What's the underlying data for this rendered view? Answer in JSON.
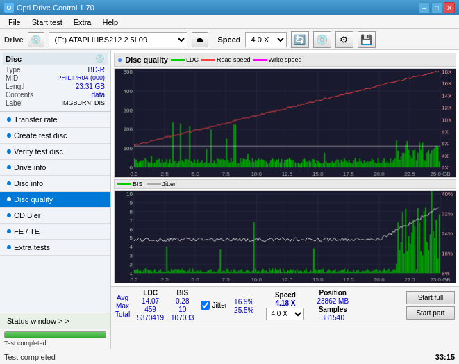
{
  "titlebar": {
    "title": "Opti Drive Control 1.70",
    "min": "–",
    "max": "□",
    "close": "✕"
  },
  "menubar": {
    "items": [
      "File",
      "Start test",
      "Extra",
      "Help"
    ]
  },
  "drivebar": {
    "label": "Drive",
    "drive_value": "(E:)  ATAPI iHBS212  2 5L09",
    "speed_label": "Speed",
    "speed_value": "4.0 X"
  },
  "disc": {
    "header": "Disc",
    "type_label": "Type",
    "type_value": "BD-R",
    "mid_label": "MID",
    "mid_value": "PHILIPR04 (000)",
    "length_label": "Length",
    "length_value": "23.31 GB",
    "contents_label": "Contents",
    "contents_value": "data",
    "label_label": "Label",
    "label_value": "IMGBURN_DIS"
  },
  "sidebar_nav": [
    {
      "id": "transfer-rate",
      "label": "Transfer rate",
      "active": false
    },
    {
      "id": "create-test-disc",
      "label": "Create test disc",
      "active": false
    },
    {
      "id": "verify-test-disc",
      "label": "Verify test disc",
      "active": false
    },
    {
      "id": "drive-info",
      "label": "Drive info",
      "active": false
    },
    {
      "id": "disc-info",
      "label": "Disc info",
      "active": false
    },
    {
      "id": "disc-quality",
      "label": "Disc quality",
      "active": true
    },
    {
      "id": "cd-bier",
      "label": "CD Bier",
      "active": false
    },
    {
      "id": "fe-te",
      "label": "FE / TE",
      "active": false
    },
    {
      "id": "extra-tests",
      "label": "Extra tests",
      "active": false
    }
  ],
  "status_window_btn": "Status window > >",
  "progress": {
    "percent": 100,
    "text": "Test completed"
  },
  "chart_quality": {
    "title": "Disc quality",
    "legend": [
      {
        "name": "LDC",
        "color": "#00cc00"
      },
      {
        "name": "Read speed",
        "color": "#ff0000"
      },
      {
        "name": "Write speed",
        "color": "#ff00ff"
      }
    ],
    "y_labels_left": [
      "500",
      "400",
      "300",
      "200",
      "100",
      "0"
    ],
    "y_labels_right": [
      "18X",
      "16X",
      "14X",
      "12X",
      "10X",
      "8X",
      "6X",
      "4X",
      "2X"
    ],
    "x_labels": [
      "0.0",
      "2.5",
      "5.0",
      "7.5",
      "10.0",
      "12.5",
      "15.0",
      "17.5",
      "20.0",
      "22.5",
      "25.0 GB"
    ]
  },
  "chart_bis": {
    "legend": [
      {
        "name": "BIS",
        "color": "#00cc00"
      },
      {
        "name": "Jitter",
        "color": "#ffffff"
      }
    ],
    "y_labels_left": [
      "10",
      "9",
      "8",
      "7",
      "6",
      "5",
      "4",
      "3",
      "2",
      "1"
    ],
    "y_labels_right": [
      "40%",
      "32%",
      "24%",
      "16%",
      "8%"
    ],
    "x_labels": [
      "0.0",
      "2.5",
      "5.0",
      "7.5",
      "10.0",
      "12.5",
      "15.0",
      "17.5",
      "20.0",
      "22.5",
      "25.0 GB"
    ]
  },
  "stats": {
    "headers": [
      "",
      "LDC",
      "BIS",
      "",
      "Jitter",
      "Speed",
      "",
      ""
    ],
    "avg_label": "Avg",
    "avg_ldc": "14.07",
    "avg_bis": "0.28",
    "avg_jitter": "16.9%",
    "max_label": "Max",
    "max_ldc": "459",
    "max_bis": "10",
    "max_jitter": "25.5%",
    "total_label": "Total",
    "total_ldc": "5370419",
    "total_bis": "107033",
    "speed_current": "4.18 X",
    "speed_select": "4.0 X",
    "position_label": "Position",
    "position_value": "23862 MB",
    "samples_label": "Samples",
    "samples_value": "381540"
  },
  "buttons": {
    "start_full": "Start full",
    "start_part": "Start part"
  },
  "statusbar": {
    "left": "Test completed",
    "time": "33:15"
  }
}
